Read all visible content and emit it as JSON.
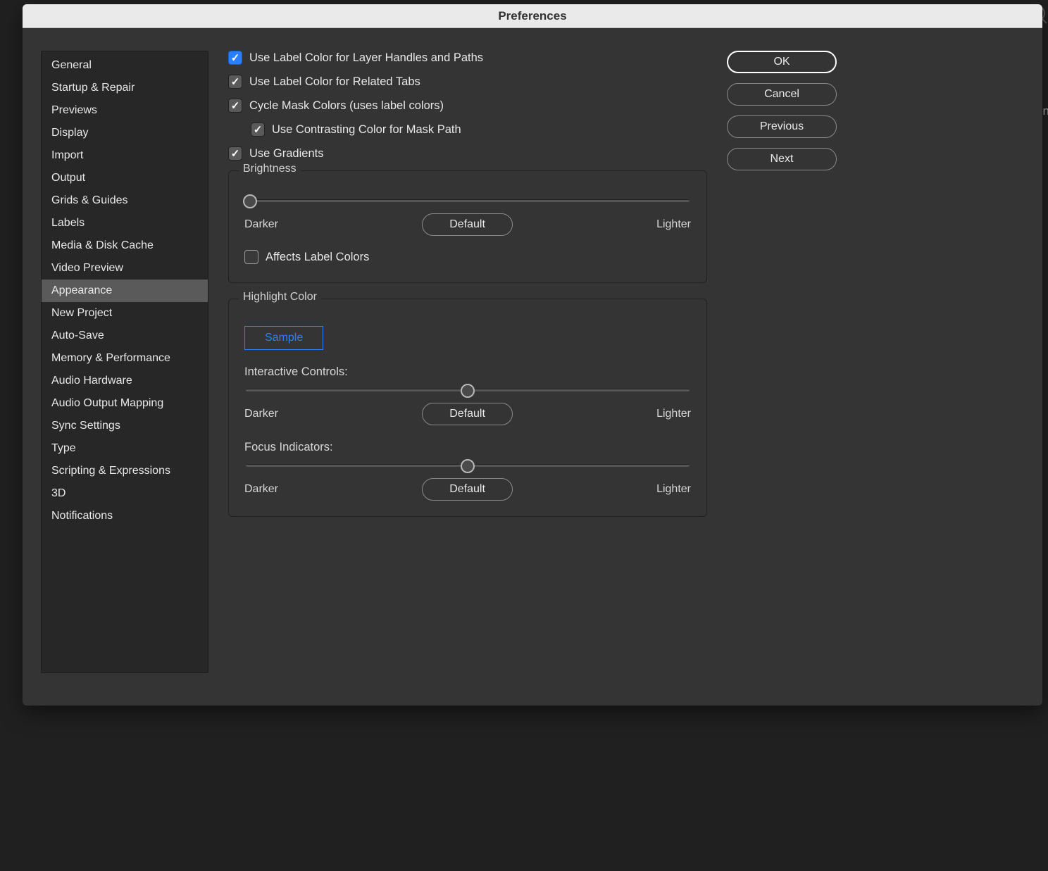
{
  "dialog": {
    "title": "Preferences"
  },
  "sidebar": {
    "items": [
      {
        "label": "General"
      },
      {
        "label": "Startup & Repair"
      },
      {
        "label": "Previews"
      },
      {
        "label": "Display"
      },
      {
        "label": "Import"
      },
      {
        "label": "Output"
      },
      {
        "label": "Grids & Guides"
      },
      {
        "label": "Labels"
      },
      {
        "label": "Media & Disk Cache"
      },
      {
        "label": "Video Preview"
      },
      {
        "label": "Appearance"
      },
      {
        "label": "New Project"
      },
      {
        "label": "Auto-Save"
      },
      {
        "label": "Memory & Performance"
      },
      {
        "label": "Audio Hardware"
      },
      {
        "label": "Audio Output Mapping"
      },
      {
        "label": "Sync Settings"
      },
      {
        "label": "Type"
      },
      {
        "label": "Scripting & Expressions"
      },
      {
        "label": "3D"
      },
      {
        "label": "Notifications"
      }
    ],
    "active_index": 10
  },
  "checks": {
    "label_layer_handles": {
      "label": "Use Label Color for Layer Handles and Paths",
      "checked": true,
      "accent": true
    },
    "label_related_tabs": {
      "label": "Use Label Color for Related Tabs",
      "checked": true
    },
    "cycle_mask": {
      "label": "Cycle Mask Colors (uses label colors)",
      "checked": true
    },
    "contrast_mask_path": {
      "label": "Use Contrasting Color for Mask Path",
      "checked": true
    },
    "use_gradients": {
      "label": "Use Gradients",
      "checked": true
    },
    "affects_label_colors": {
      "label": "Affects Label Colors",
      "checked": false
    }
  },
  "brightness": {
    "legend": "Brightness",
    "darker": "Darker",
    "lighter": "Lighter",
    "default_btn": "Default",
    "value_pct": 1
  },
  "highlight": {
    "legend": "Highlight Color",
    "sample": "Sample",
    "interactive_label": "Interactive Controls:",
    "focus_label": "Focus Indicators:",
    "darker": "Darker",
    "lighter": "Lighter",
    "default_btn": "Default",
    "interactive_value_pct": 50,
    "focus_value_pct": 50
  },
  "buttons": {
    "ok": "OK",
    "cancel": "Cancel",
    "previous": "Previous",
    "next": "Next"
  },
  "background": {
    "partial_text": "on"
  }
}
